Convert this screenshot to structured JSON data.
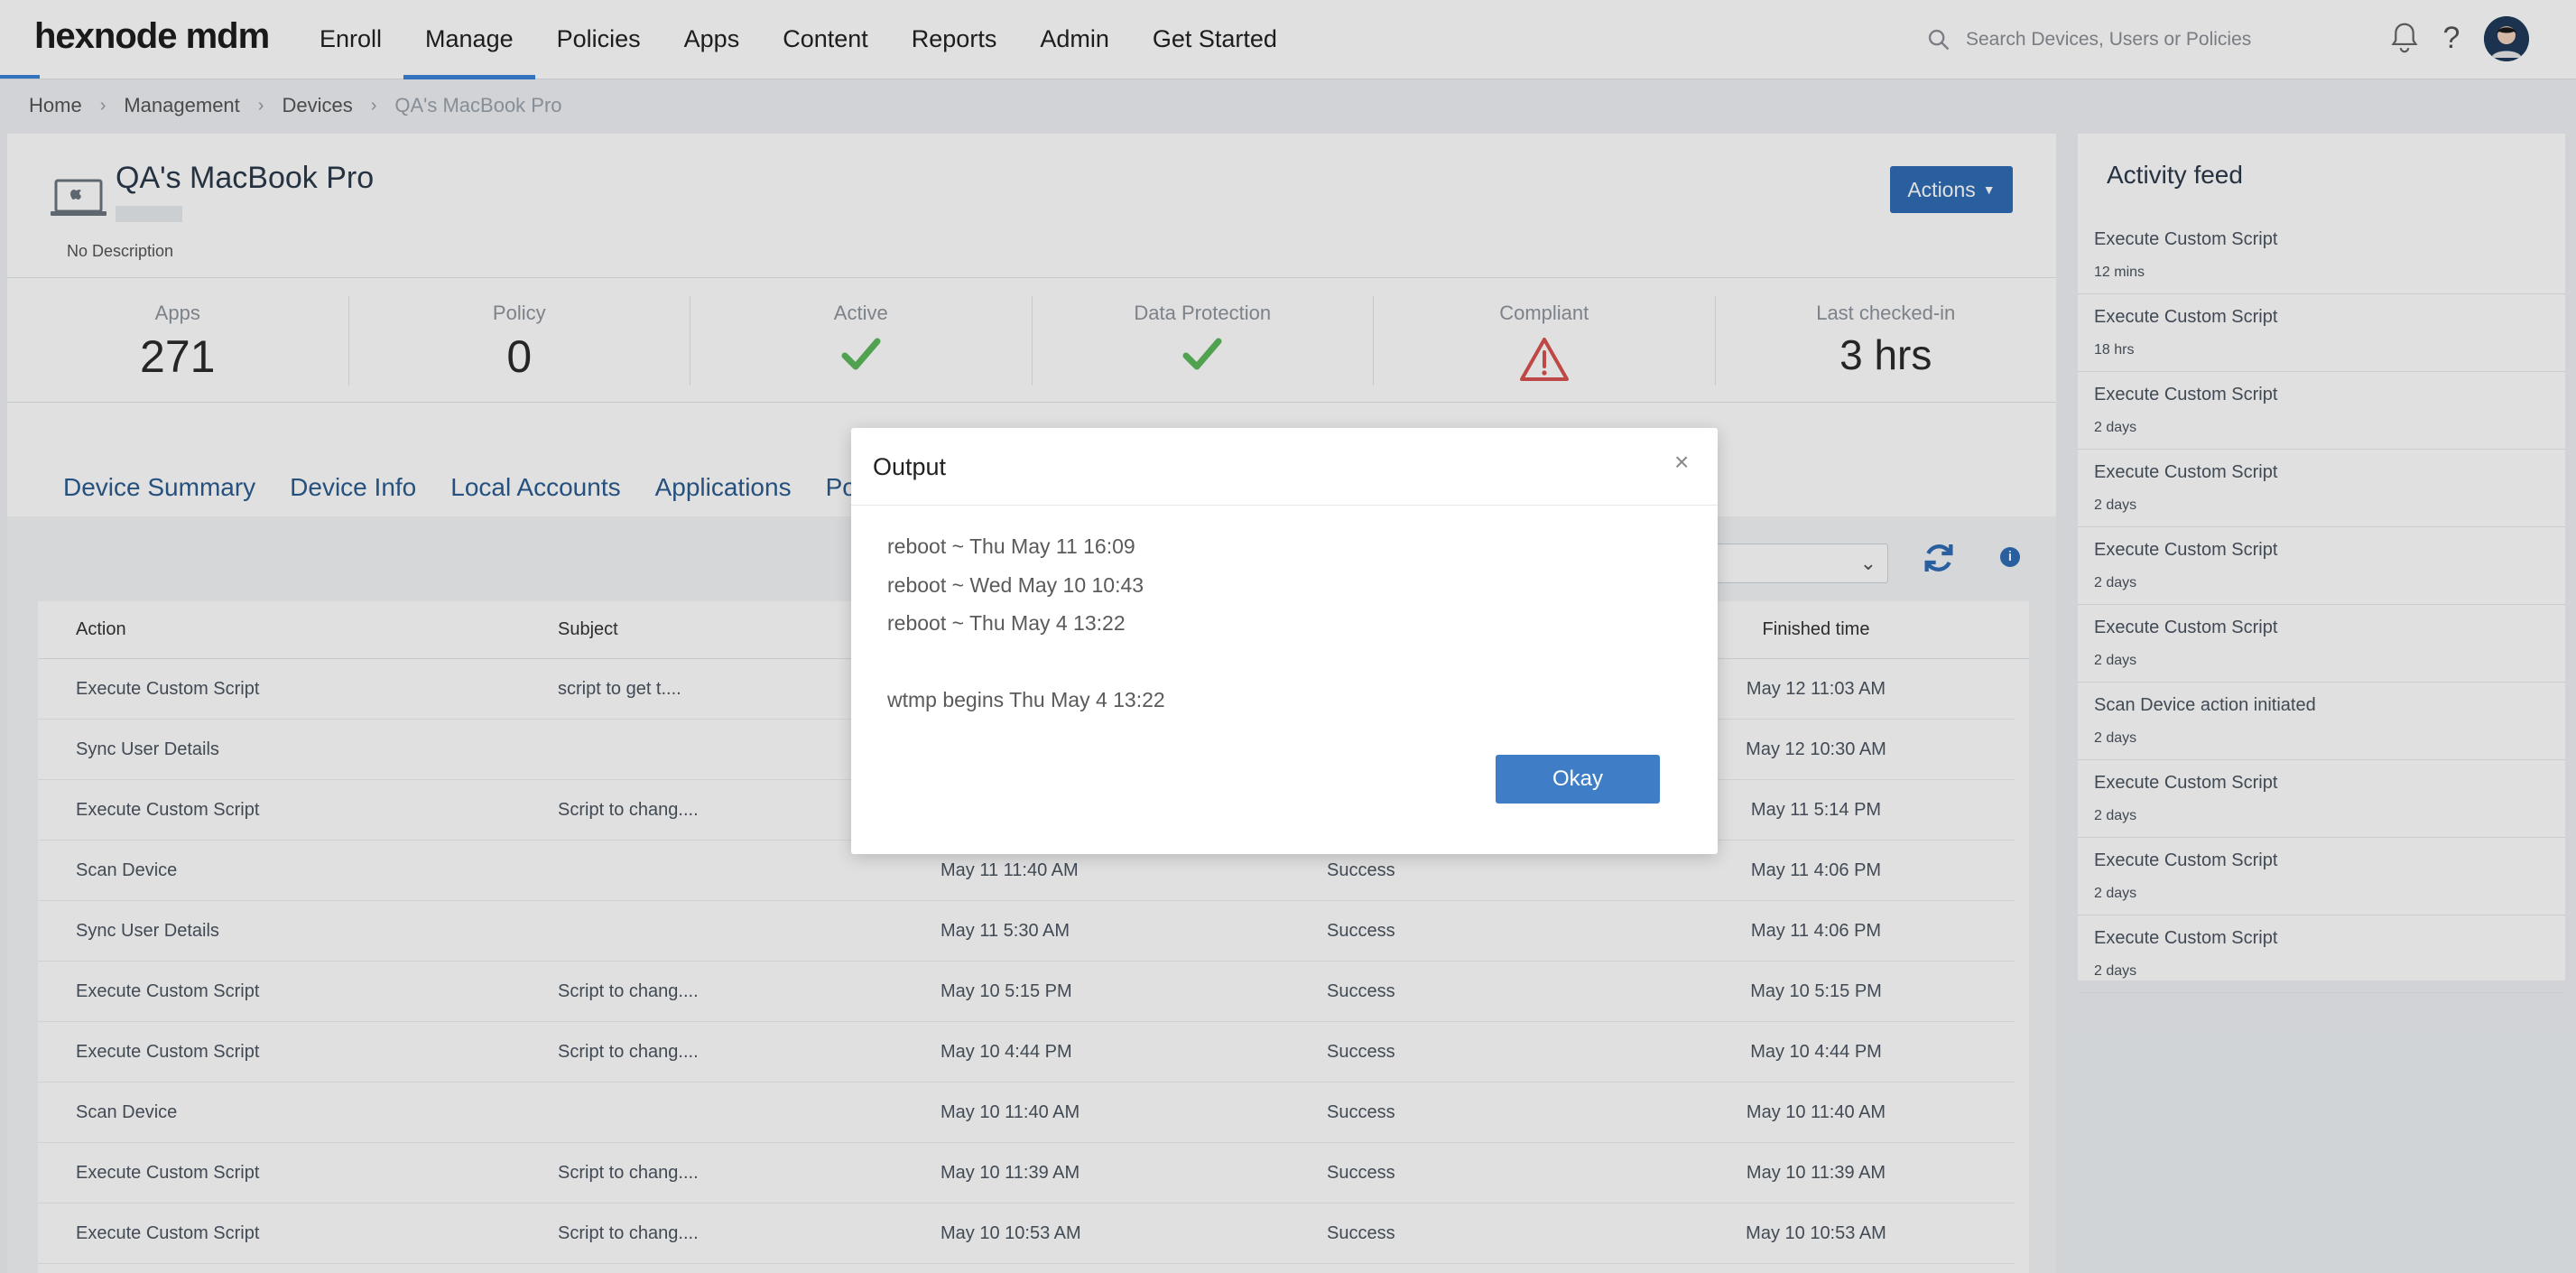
{
  "brand": {
    "logo_text": "hexnode mdm"
  },
  "nav": {
    "items": [
      {
        "label": "Enroll"
      },
      {
        "label": "Manage",
        "active": true
      },
      {
        "label": "Policies"
      },
      {
        "label": "Apps"
      },
      {
        "label": "Content"
      },
      {
        "label": "Reports"
      },
      {
        "label": "Admin"
      },
      {
        "label": "Get Started"
      }
    ]
  },
  "search": {
    "placeholder": "Search Devices, Users or Policies",
    "icon": "search-icon"
  },
  "header_icons": [
    "bell-icon",
    "help-icon",
    "avatar"
  ],
  "breadcrumb": [
    "Home",
    "Management",
    "Devices",
    "QA's MacBook Pro"
  ],
  "device": {
    "name": "QA's MacBook Pro",
    "description": "No Description",
    "actions_label": "Actions"
  },
  "stats": [
    {
      "label": "Apps",
      "value": "271"
    },
    {
      "label": "Policy",
      "value": "0"
    },
    {
      "label": "Active",
      "icon": "check-icon"
    },
    {
      "label": "Data Protection",
      "icon": "check-icon"
    },
    {
      "label": "Compliant",
      "icon": "warning-icon"
    },
    {
      "label": "Last checked-in",
      "value": "3 hrs"
    }
  ],
  "tabs": [
    "Device Summary",
    "Device Info",
    "Local Accounts",
    "Applications",
    "Polic"
  ],
  "table": {
    "headers": {
      "action": "Action",
      "subject": "Subject",
      "finished": "Finished time"
    },
    "rows": [
      {
        "action": "Execute Custom Script",
        "subject": "script to get t....",
        "initiated": "",
        "status": "",
        "finished": "May 12 11:03 AM"
      },
      {
        "action": "Sync User Details",
        "subject": "",
        "initiated": "",
        "status": "",
        "finished": "May 12 10:30 AM"
      },
      {
        "action": "Execute Custom Script",
        "subject": "Script to chang....",
        "initiated": "",
        "status": "",
        "finished": "May 11 5:14 PM"
      },
      {
        "action": "Scan Device",
        "subject": "",
        "initiated": "May 11 11:40 AM",
        "status": "Success",
        "finished": "May 11 4:06 PM"
      },
      {
        "action": "Sync User Details",
        "subject": "",
        "initiated": "May 11 5:30 AM",
        "status": "Success",
        "finished": "May 11 4:06 PM"
      },
      {
        "action": "Execute Custom Script",
        "subject": "Script to chang....",
        "initiated": "May 10 5:15 PM",
        "status": "Success",
        "finished": "May 10 5:15 PM"
      },
      {
        "action": "Execute Custom Script",
        "subject": "Script to chang....",
        "initiated": "May 10 4:44 PM",
        "status": "Success",
        "finished": "May 10 4:44 PM"
      },
      {
        "action": "Scan Device",
        "subject": "",
        "initiated": "May 10 11:40 AM",
        "status": "Success",
        "finished": "May 10 11:40 AM"
      },
      {
        "action": "Execute Custom Script",
        "subject": "Script to chang....",
        "initiated": "May 10 11:39 AM",
        "status": "Success",
        "finished": "May 10 11:39 AM"
      },
      {
        "action": "Execute Custom Script",
        "subject": "Script to chang....",
        "initiated": "May 10 10:53 AM",
        "status": "Success",
        "finished": "May 10 10:53 AM"
      }
    ]
  },
  "activity_feed": {
    "title": "Activity feed",
    "items": [
      {
        "title": "Execute Custom Script",
        "time": "12 mins"
      },
      {
        "title": "Execute Custom Script",
        "time": "18 hrs"
      },
      {
        "title": "Execute Custom Script",
        "time": "2 days"
      },
      {
        "title": "Execute Custom Script",
        "time": "2 days"
      },
      {
        "title": "Execute Custom Script",
        "time": "2 days"
      },
      {
        "title": "Execute Custom Script",
        "time": "2 days"
      },
      {
        "title": "Scan Device action initiated",
        "time": "2 days"
      },
      {
        "title": "Execute Custom Script",
        "time": "2 days"
      },
      {
        "title": "Execute Custom Script",
        "time": "2 days"
      },
      {
        "title": "Execute Custom Script",
        "time": "2 days"
      }
    ]
  },
  "modal": {
    "title": "Output",
    "close": "×",
    "lines": [
      "reboot ~ Thu May 11 16:09",
      "reboot ~ Wed May 10 10:43",
      "reboot ~ Thu May 4 13:22",
      "",
      "wtmp begins Thu May 4 13:22"
    ],
    "okay_label": "Okay"
  },
  "colors": {
    "accent": "#3b82d6",
    "button": "#2f6db5",
    "success": "#5cb85c",
    "warning": "#d9534f"
  }
}
